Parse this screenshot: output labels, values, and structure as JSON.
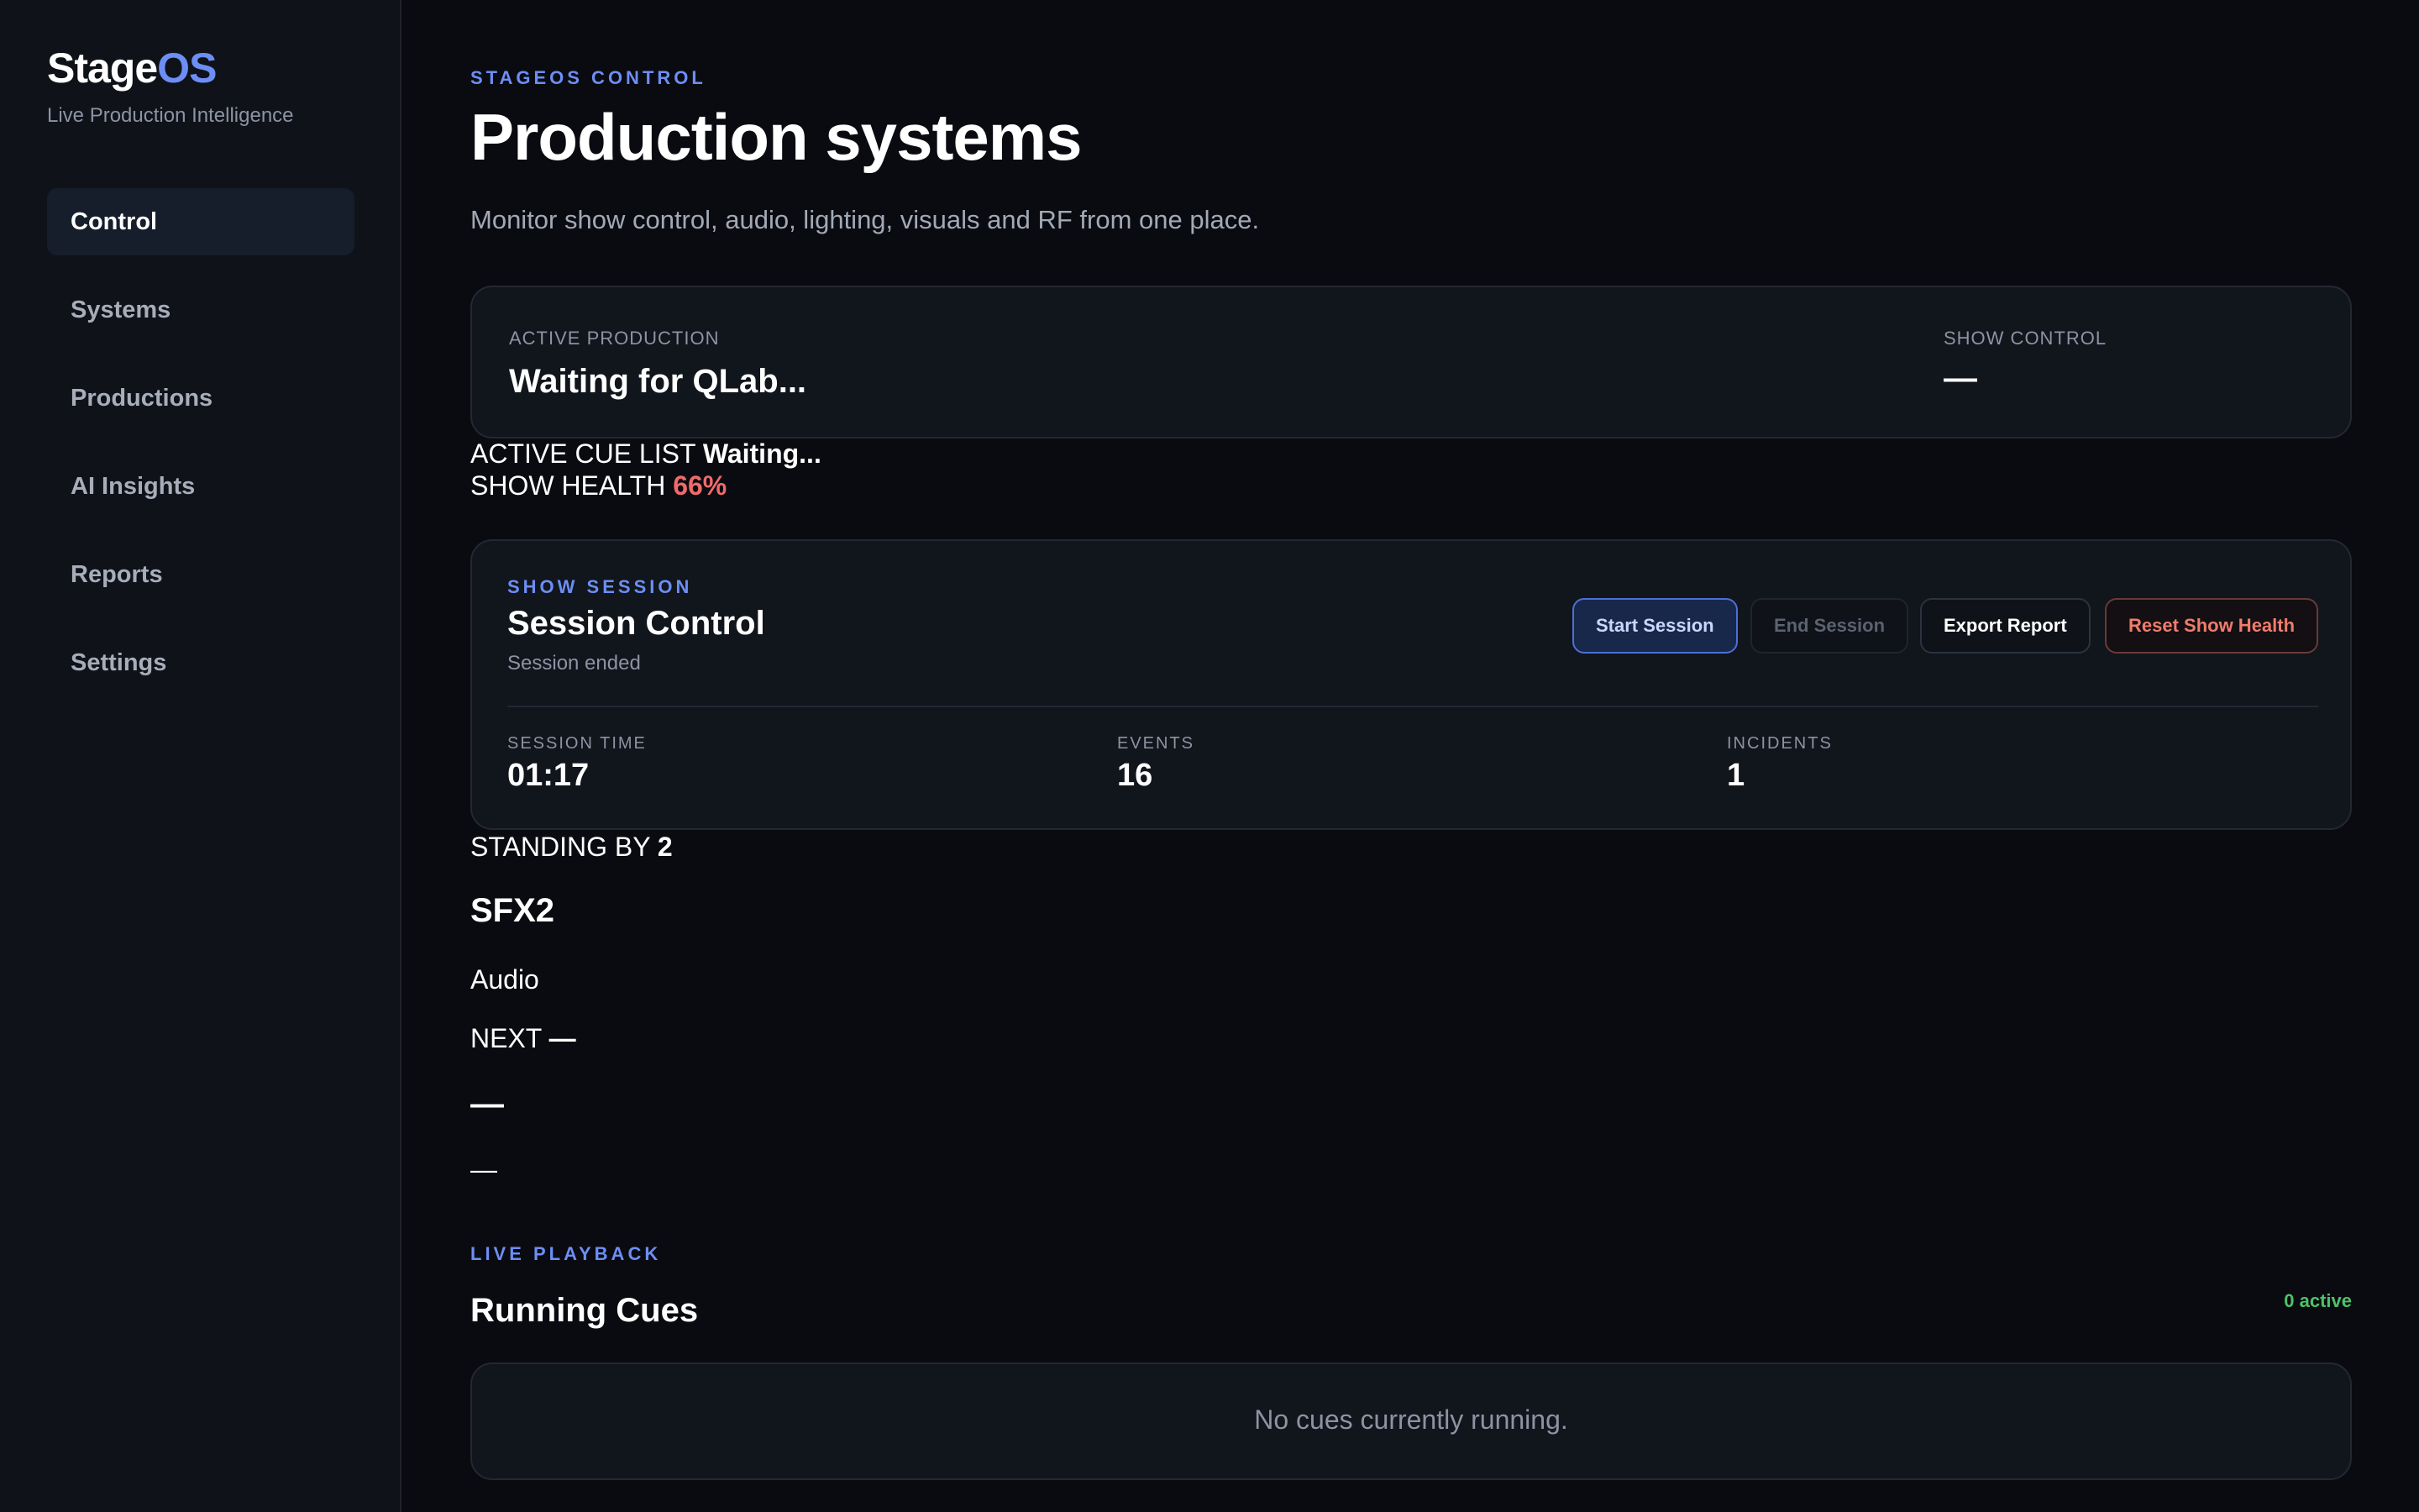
{
  "brand": {
    "name_part1": "Stage",
    "name_part2": "OS",
    "subtitle": "Live Production Intelligence"
  },
  "nav": {
    "items": [
      {
        "label": "Control",
        "active": true
      },
      {
        "label": "Systems"
      },
      {
        "label": "Productions"
      },
      {
        "label": "AI Insights"
      },
      {
        "label": "Reports"
      },
      {
        "label": "Settings"
      }
    ]
  },
  "header": {
    "eyebrow": "STAGEOS CONTROL",
    "title": "Production systems",
    "description": "Monitor show control, audio, lighting, visuals and RF from one place."
  },
  "production": {
    "active_label": "ACTIVE PRODUCTION",
    "active_value": "Waiting for QLab...",
    "show_control_label": "SHOW CONTROL",
    "show_control_value": "—"
  },
  "cue_list": {
    "label": "ACTIVE CUE LIST",
    "value": "Waiting..."
  },
  "health": {
    "label": "SHOW HEALTH",
    "value": "66%"
  },
  "session": {
    "eyebrow": "SHOW SESSION",
    "title": "Session Control",
    "status": "Session ended",
    "buttons": {
      "start": "Start Session",
      "end": "End Session",
      "export": "Export Report",
      "reset": "Reset Show Health"
    },
    "metrics": [
      {
        "label": "SESSION TIME",
        "value": "01:17"
      },
      {
        "label": "EVENTS",
        "value": "16"
      },
      {
        "label": "INCIDENTS",
        "value": "1"
      }
    ]
  },
  "standing_by": {
    "label": "STANDING BY",
    "value": "2",
    "cue_name": "SFX2",
    "cue_type": "Audio",
    "next_label": "NEXT",
    "next_value": "—",
    "next_name": "—",
    "next_type": "—"
  },
  "live": {
    "eyebrow": "LIVE PLAYBACK",
    "title": "Running Cues",
    "active_count": "0 active",
    "empty": "No cues currently running."
  },
  "colors": {
    "accent": "#6c8ef5",
    "danger": "#f06b6b",
    "success": "#4cc26a",
    "background": "#0a0b10",
    "sidebar": "#0f1218"
  }
}
